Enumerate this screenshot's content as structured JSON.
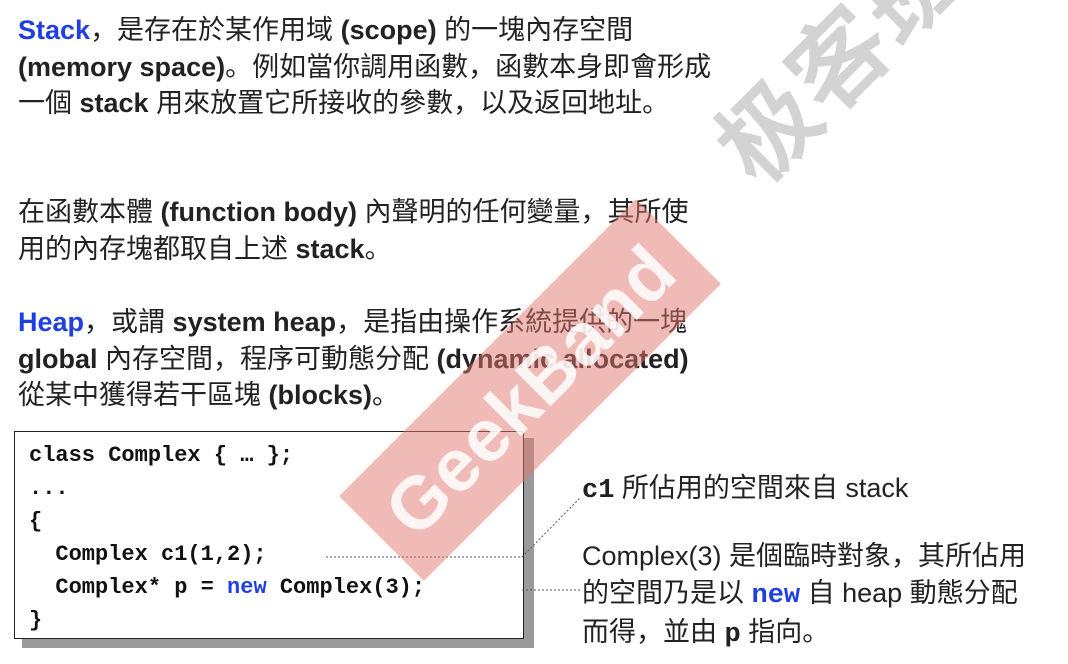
{
  "para1": {
    "term": "Stack",
    "text_a": "，是存在於某作用域 ",
    "scope": "(scope)",
    "text_b": " 的一塊內存空間",
    "memspace": "(memory space)",
    "text_c": "。例如當你調用函數，函數本身即會形成一個 ",
    "stack": "stack",
    "text_d": " 用來放置它所接收的參數，以及返回地址。"
  },
  "para2": {
    "text_a": "在函數本體 ",
    "fbody": "(function body)",
    "text_b": " 內聲明的任何變量，其所使用的內存塊都取自上述 ",
    "stack": "stack",
    "text_c": "。"
  },
  "para3": {
    "term": "Heap",
    "text_a": "，或謂 ",
    "sysheap": "system heap",
    "text_b": "，是指由操作系統提供的一塊 ",
    "global": "global",
    "text_c": " 內存空間，程序可動態分配 ",
    "dynamic": "(dynamic allocated)",
    "text_d": " 從某中獲得若干區塊 ",
    "blocks": "(blocks)",
    "text_e": "。"
  },
  "code": {
    "line1": "class Complex { … };",
    "line2": "...",
    "line3": "{",
    "line4": "  Complex c1(1,2);",
    "line5_a": "  Complex* p = ",
    "line5_kw": "new",
    "line5_b": " Complex(3);",
    "line6": "}"
  },
  "note1": {
    "code": "c1",
    "text": " 所佔用的空間來自 stack"
  },
  "note2": {
    "text_a": "Complex(3) 是個臨時對象，其所佔用的空間乃是以 ",
    "kw": "new",
    "text_b": " 自 heap 動態分配而得，並由 ",
    "p": "p",
    "text_c": " 指向。"
  },
  "watermark": {
    "band_text": "GeekBand",
    "cn_text": "极客班"
  },
  "colors": {
    "accent_blue": "#1f3fe0",
    "watermark_band": "#e2786e"
  }
}
